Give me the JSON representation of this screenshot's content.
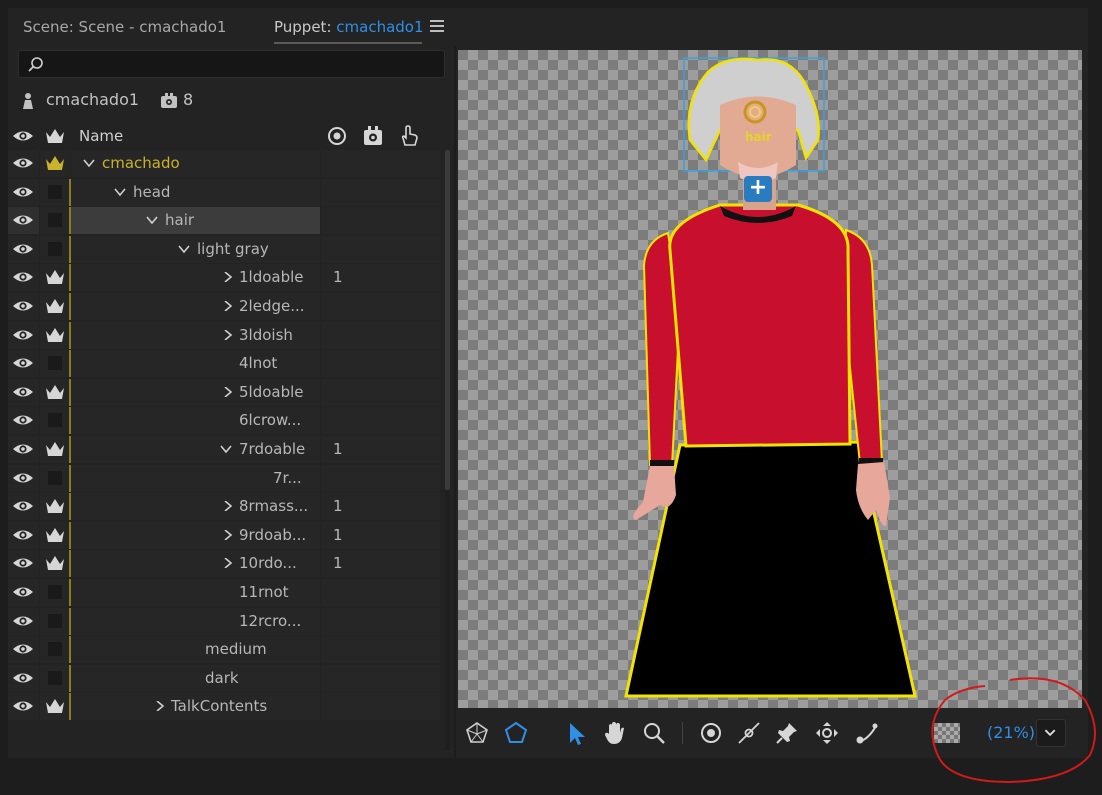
{
  "tabs": {
    "scene": "Scene: Scene - cmachado1",
    "puppet_prefix": "Puppet: ",
    "puppet_name": "cmachado1"
  },
  "search": {
    "placeholder": ""
  },
  "puppet_info": {
    "name": "cmachado1",
    "behavior_count": "8"
  },
  "columns": {
    "name": "Name"
  },
  "rows": [
    {
      "label": "cmachado",
      "value": "",
      "yellow": true,
      "crown": "yellow",
      "expanded": true
    },
    {
      "label": "head",
      "value": "",
      "crown": "none",
      "expanded": true
    },
    {
      "label": "hair",
      "value": "",
      "crown": "none",
      "expanded": true,
      "selected": true
    },
    {
      "label": "light gray",
      "value": "",
      "crown": "none",
      "expanded": true
    },
    {
      "label": "1ldoable",
      "value": "1",
      "crown": "white",
      "expanded": false
    },
    {
      "label": "2ledge...",
      "value": "",
      "crown": "white",
      "expanded": false
    },
    {
      "label": "3ldoish",
      "value": "",
      "crown": "white",
      "expanded": false
    },
    {
      "label": "4lnot",
      "value": "",
      "crown": "none"
    },
    {
      "label": "5ldoable",
      "value": "",
      "crown": "white",
      "expanded": false
    },
    {
      "label": "6lcrow...",
      "value": "",
      "crown": "none"
    },
    {
      "label": "7rdoable",
      "value": "1",
      "crown": "white",
      "expanded": true
    },
    {
      "label": "7r...",
      "value": "",
      "crown": "none"
    },
    {
      "label": "8rmass...",
      "value": "1",
      "crown": "white",
      "expanded": false
    },
    {
      "label": "9rdoab...",
      "value": "1",
      "crown": "white",
      "expanded": false
    },
    {
      "label": "10rdo...",
      "value": "1",
      "crown": "white",
      "expanded": false
    },
    {
      "label": "11rnot",
      "value": "",
      "crown": "none"
    },
    {
      "label": "12rcro...",
      "value": "",
      "crown": "none"
    },
    {
      "label": "medium",
      "value": "",
      "crown": "none"
    },
    {
      "label": "dark",
      "value": "",
      "crown": "none"
    },
    {
      "label": "TalkContents",
      "value": "",
      "crown": "white",
      "expanded": false
    }
  ],
  "canvas": {
    "handle_label": "hair",
    "add_handle_label": "+"
  },
  "toolbar": {
    "tools": [
      "warp-tool-icon",
      "mesh-outline-tool-icon",
      "select-tool-icon",
      "hand-tool-icon",
      "zoom-tool-icon",
      "origin-handle-icon",
      "stick-tool-icon",
      "pin-tool-icon",
      "dragger-tool-icon",
      "hook-tool-icon"
    ],
    "zoom": "(21%)"
  },
  "colors": {
    "accent": "#2f8fe6",
    "selection_yellow": "#e8e000",
    "annotation_red": "#d11a1a"
  }
}
